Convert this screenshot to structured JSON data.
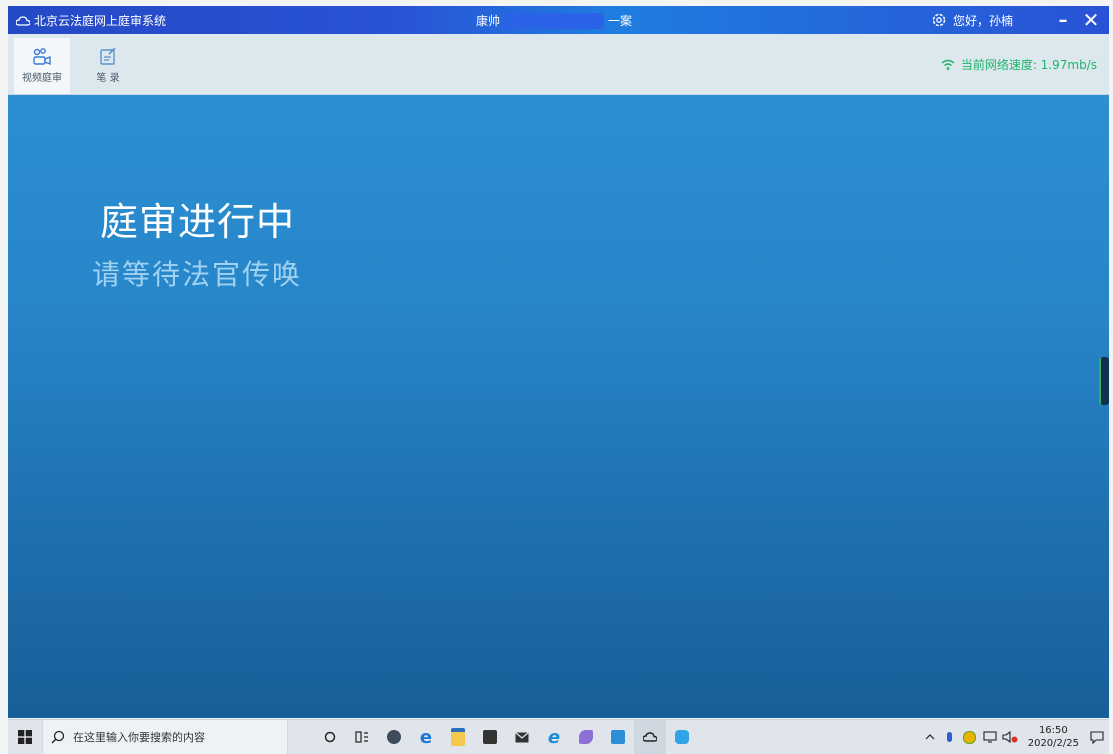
{
  "window": {
    "app_title": "北京云法庭网上庭审系统",
    "case_name_left": "康帅",
    "case_name_right": "一案",
    "greeting": "您好，孙楠",
    "min_label": "–",
    "close_label": "✕"
  },
  "toolbar": {
    "tools": [
      {
        "label": "视频庭审",
        "icon": "video-court-icon",
        "active": true
      },
      {
        "label": "笔 录",
        "icon": "notes-icon",
        "active": false
      }
    ],
    "network_label": "当前网络速度: 1.97mb/s"
  },
  "stage": {
    "status_title": "庭审进行中",
    "status_subtitle": "请等待法官传唤"
  },
  "taskbar": {
    "search_placeholder": "在这里输入你要搜索的内容",
    "time": "16:50",
    "date": "2020/2/25",
    "tasks": [
      "cortana-icon",
      "task-view-icon",
      "app-icon",
      "edge-icon",
      "file-explorer-icon",
      "store-icon",
      "mail-icon",
      "ie-icon",
      "paint-icon",
      "photos-icon",
      "cloud-court-icon",
      "browser-icon"
    ]
  },
  "colors": {
    "titlebar": "#2449c5",
    "stage_top": "#2b8fd3",
    "stage_bottom": "#175f98",
    "network_text": "#20b46a",
    "subtitle": "#9fd2f2"
  }
}
